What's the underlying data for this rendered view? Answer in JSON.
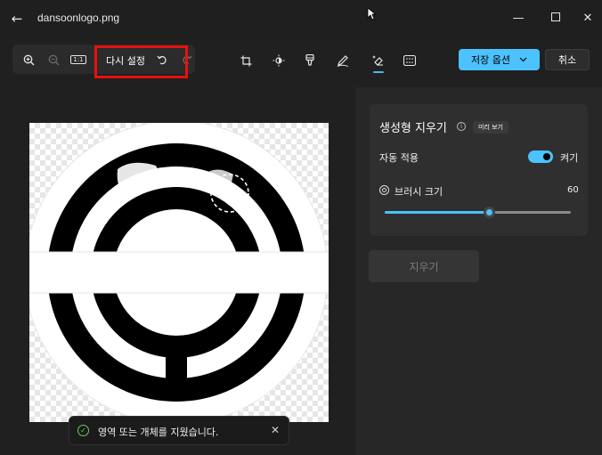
{
  "window": {
    "title": "dansoonlogo.png"
  },
  "toolbar": {
    "reset_label": "다시 설정",
    "zoom_label": "1:1",
    "save_label": "저장 옵션",
    "cancel_label": "취소"
  },
  "panel": {
    "title": "생성형 지우기",
    "preview_badge": "미리 보기",
    "auto_apply_label": "자동 적용",
    "auto_apply_state": "켜기",
    "auto_apply_on": true,
    "brush_size_label": "브러시 크기",
    "brush_size_value": "60",
    "brush_size_fraction": 0.56,
    "erase_button": "지우기"
  },
  "toast": {
    "message": "영역 또는 개체를 지웠습니다."
  },
  "colors": {
    "accent": "#4cc2ff",
    "highlight": "#e81010",
    "success": "#6ccb5f"
  }
}
